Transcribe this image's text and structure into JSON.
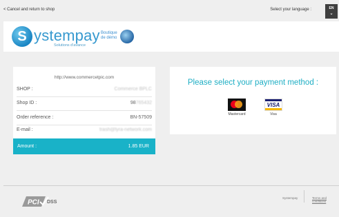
{
  "topbar": {
    "back_link": "< Cancel and return to shop",
    "language_label": "Select your language :",
    "language_code": "EN",
    "language_chevron": "⌄"
  },
  "header": {
    "logo_letter": "S",
    "logo_text": "ystempay",
    "logo_tagline": "Solutions d'avance",
    "shop_name_line1": "Boutique",
    "shop_name_line2": "de démo"
  },
  "order": {
    "url": "http://www.commercetpic.com",
    "rows": [
      {
        "label": "SHOP :",
        "value": "Commerce BPLC"
      },
      {
        "label": "Shop ID :",
        "value_visible": "98",
        "value_blurred": "765432"
      },
      {
        "label": "Order reference :",
        "value": "BN-57509"
      },
      {
        "label": "E-mail :",
        "value": "trash@lyra-network.com"
      }
    ],
    "amount_label": "Amount :",
    "amount_value": "1.85 EUR"
  },
  "payment": {
    "title": "Please select your payment method :",
    "methods": [
      {
        "name": "Mastercard",
        "icon": "mastercard-icon"
      },
      {
        "name": "Visa",
        "icon": "visa-icon",
        "brand_text": "VISA"
      }
    ]
  },
  "footer": {
    "pci_text": "DSS",
    "brand": "Systempay",
    "link": "Terms and conditions"
  },
  "colors": {
    "accent": "#19b2c8",
    "logo_blue": "#3699cf"
  }
}
